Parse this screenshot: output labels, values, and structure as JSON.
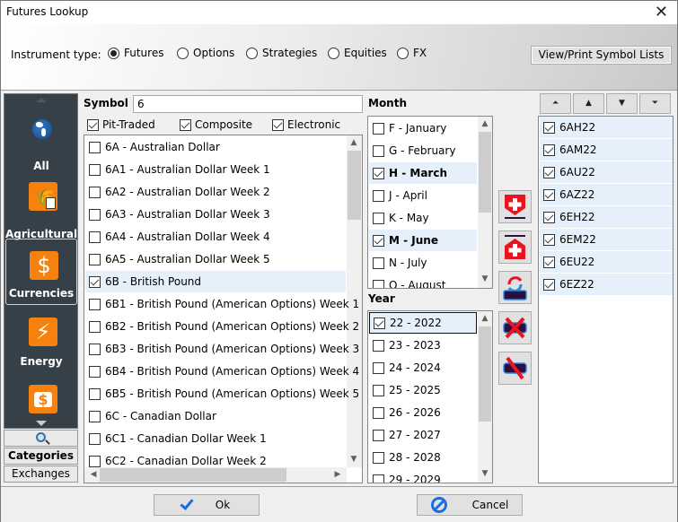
{
  "window": {
    "title": "Futures Lookup",
    "close_icon": "close-icon"
  },
  "instrument_type": {
    "label": "Instrument type:",
    "options": [
      {
        "label": "Futures",
        "selected": true
      },
      {
        "label": "Options",
        "selected": false
      },
      {
        "label": "Strategies",
        "selected": false
      },
      {
        "label": "Equities",
        "selected": false
      },
      {
        "label": "FX",
        "selected": false
      }
    ]
  },
  "view_print_button": "View/Print Symbol Lists",
  "sidebar": {
    "items": [
      {
        "label": "All",
        "icon": "globe-icon",
        "active": false
      },
      {
        "label": "Agricultural",
        "icon": "wheat-document-icon",
        "active": false
      },
      {
        "label": "Currencies",
        "icon": "dollar-icon",
        "active": true
      },
      {
        "label": "Energy",
        "icon": "lightning-icon",
        "active": false
      },
      {
        "label": "",
        "icon": "money-bag-icon",
        "active": false
      }
    ],
    "search_icon": "search-icon",
    "categories_label": "Categories",
    "exchanges_label": "Exchanges"
  },
  "symbol": {
    "label": "Symbol",
    "value": "6",
    "filters": [
      {
        "label": "Pit-Traded",
        "checked": true
      },
      {
        "label": "Composite",
        "checked": true
      },
      {
        "label": "Electronic",
        "checked": true
      }
    ],
    "items": [
      {
        "label": "6A - Australian Dollar",
        "checked": false
      },
      {
        "label": "6A1 - Australian Dollar Week 1",
        "checked": false
      },
      {
        "label": "6A2 - Australian Dollar Week 2",
        "checked": false
      },
      {
        "label": "6A3 - Australian Dollar Week 3",
        "checked": false
      },
      {
        "label": "6A4 - Australian Dollar Week 4",
        "checked": false
      },
      {
        "label": "6A5 - Australian Dollar Week 5",
        "checked": false
      },
      {
        "label": "6B - British Pound",
        "checked": true
      },
      {
        "label": "6B1 - British Pound (American Options) Week 1",
        "checked": false
      },
      {
        "label": "6B2 - British Pound (American Options) Week 2",
        "checked": false
      },
      {
        "label": "6B3 - British Pound (American Options) Week 3",
        "checked": false
      },
      {
        "label": "6B4 - British Pound (American Options) Week 4",
        "checked": false
      },
      {
        "label": "6B5 - British Pound (American Options) Week 5",
        "checked": false
      },
      {
        "label": "6C - Canadian Dollar",
        "checked": false
      },
      {
        "label": "6C1 - Canadian Dollar Week 1",
        "checked": false
      },
      {
        "label": "6C2 - Canadian Dollar Week 2",
        "checked": false
      }
    ]
  },
  "month": {
    "label": "Month",
    "items": [
      {
        "label": "F - January",
        "checked": false
      },
      {
        "label": "G - February",
        "checked": false
      },
      {
        "label": "H - March",
        "checked": true
      },
      {
        "label": "J - April",
        "checked": false
      },
      {
        "label": "K - May",
        "checked": false
      },
      {
        "label": "M - June",
        "checked": true
      },
      {
        "label": "N - July",
        "checked": false
      },
      {
        "label": "Q - August",
        "checked": false
      }
    ]
  },
  "year": {
    "label": "Year",
    "items": [
      {
        "label": "22 - 2022",
        "checked": true
      },
      {
        "label": "23 - 2023",
        "checked": false
      },
      {
        "label": "24 - 2024",
        "checked": false
      },
      {
        "label": "25 - 2025",
        "checked": false
      },
      {
        "label": "26 - 2026",
        "checked": false
      },
      {
        "label": "27 - 2027",
        "checked": false
      },
      {
        "label": "28 - 2028",
        "checked": false
      },
      {
        "label": "29 - 2029",
        "checked": false
      }
    ]
  },
  "actions": [
    {
      "name": "add-below-button",
      "icon": "add-below-icon"
    },
    {
      "name": "add-above-button",
      "icon": "add-above-icon"
    },
    {
      "name": "replace-button",
      "icon": "replace-icon"
    },
    {
      "name": "remove-button",
      "icon": "remove-icon"
    },
    {
      "name": "clear-button",
      "icon": "clear-icon"
    }
  ],
  "order_buttons": [
    {
      "name": "move-top-button",
      "glyph": "⏶"
    },
    {
      "name": "move-up-button",
      "glyph": "▲"
    },
    {
      "name": "move-down-button",
      "glyph": "▼"
    },
    {
      "name": "move-bottom-button",
      "glyph": "⏷"
    }
  ],
  "selected_symbols": [
    {
      "label": "6AH22",
      "checked": true
    },
    {
      "label": "6AM22",
      "checked": true
    },
    {
      "label": "6AU22",
      "checked": true
    },
    {
      "label": "6AZ22",
      "checked": true
    },
    {
      "label": "6EH22",
      "checked": true
    },
    {
      "label": "6EM22",
      "checked": true
    },
    {
      "label": "6EU22",
      "checked": true
    },
    {
      "label": "6EZ22",
      "checked": true
    }
  ],
  "footer": {
    "ok_label": "Ok",
    "cancel_label": "Cancel"
  }
}
